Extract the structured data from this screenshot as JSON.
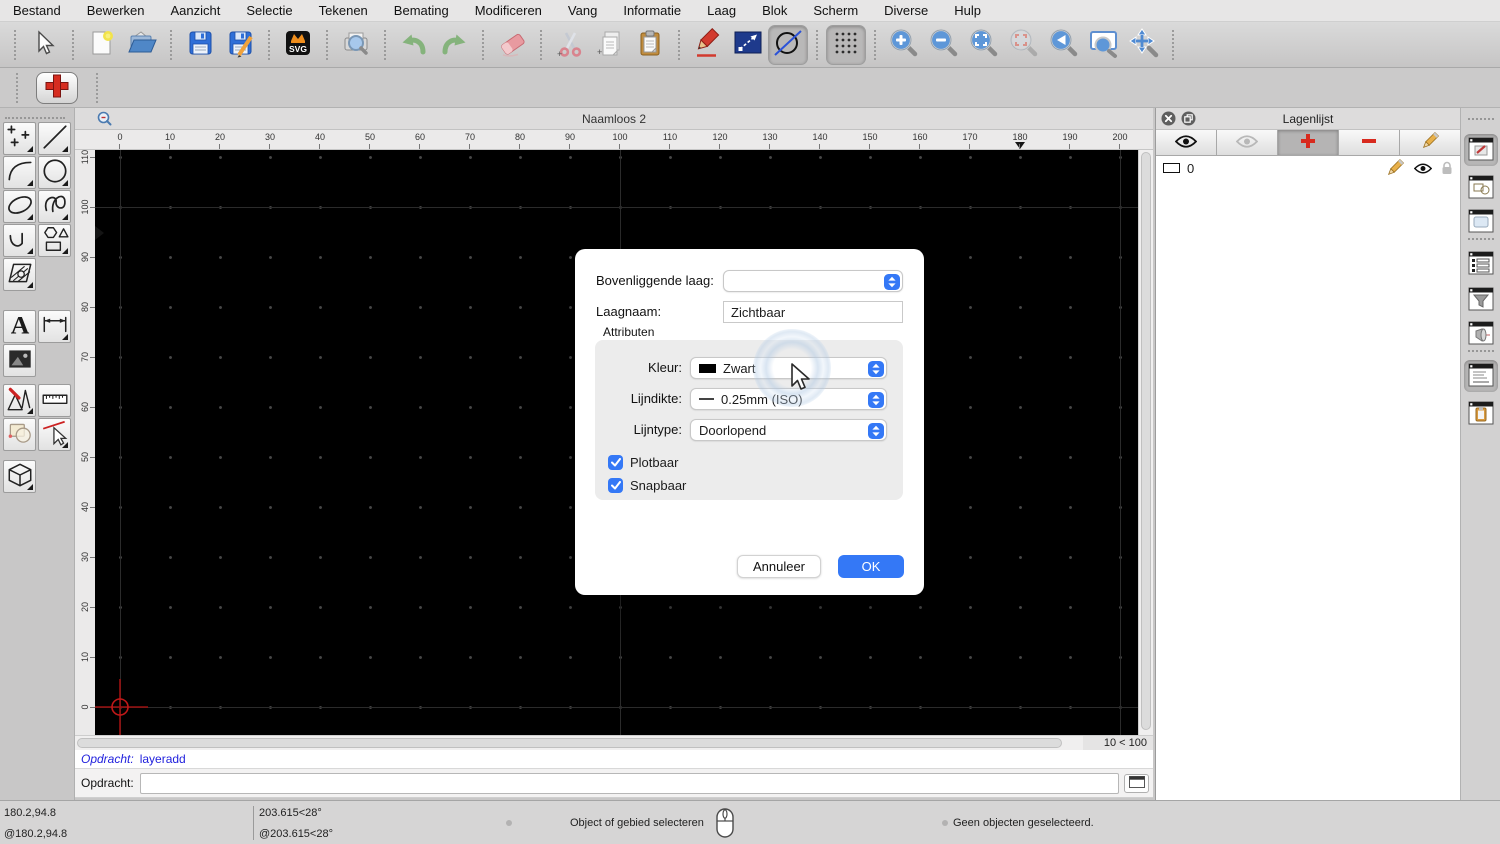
{
  "menu": {
    "items": [
      "Bestand",
      "Bewerken",
      "Aanzicht",
      "Selectie",
      "Tekenen",
      "Bemating",
      "Modificeren",
      "Vang",
      "Informatie",
      "Laag",
      "Blok",
      "Scherm",
      "Diverse",
      "Hulp"
    ]
  },
  "toolbar": {
    "groups": [
      [
        "select-arrow"
      ],
      [
        "new-file",
        "open-file"
      ],
      [
        "save",
        "save-as"
      ],
      [
        "svg-export"
      ],
      [
        "print-preview"
      ],
      [
        "undo",
        "redo"
      ],
      [
        "eraser"
      ],
      [
        "cut",
        "copy",
        "paste"
      ],
      [
        "draw-pencil",
        "scale-tool",
        "construction-mode"
      ],
      [
        "grid-toggle"
      ],
      [
        "zoom-in",
        "zoom-out",
        "zoom-auto",
        "zoom-selection",
        "zoom-previous",
        "zoom-window",
        "zoom-pan"
      ]
    ],
    "active": [
      "construction-mode",
      "grid-toggle"
    ],
    "disabled": [
      "zoom-selection"
    ]
  },
  "second_toolbar": {
    "add_layer_tool_icon": "red-plus"
  },
  "tool_palette": {
    "rows": [
      [
        {
          "name": "point-tool",
          "flyout": true
        },
        {
          "name": "line-tool",
          "flyout": true
        }
      ],
      [
        {
          "name": "arc-tool",
          "flyout": true
        },
        {
          "name": "circle-tool",
          "flyout": true
        }
      ],
      [
        {
          "name": "ellipse-tool",
          "flyout": true
        },
        {
          "name": "spline-tool",
          "flyout": true
        }
      ],
      [
        {
          "name": "polyline-tool",
          "flyout": true
        },
        {
          "name": "shape-tool",
          "flyout": true
        }
      ],
      [
        {
          "name": "hatch-tool",
          "flyout": true
        }
      ],
      [
        {
          "name": "text-tool",
          "flyout": false
        },
        {
          "name": "dimension-tool",
          "flyout": true
        }
      ],
      [
        {
          "name": "image-tool",
          "flyout": false
        }
      ],
      [
        {
          "name": "cad-draw-tool",
          "flyout": true
        },
        {
          "name": "measure-tool",
          "flyout": false
        }
      ],
      [
        {
          "name": "modify-tool",
          "flyout": false
        },
        {
          "name": "snap-tool",
          "flyout": true
        }
      ],
      [
        {
          "name": "solid-tool",
          "flyout": true
        }
      ]
    ]
  },
  "document_window": {
    "title": "Naamloos 2",
    "h_ruler_values": [
      0,
      10,
      20,
      30,
      40,
      50,
      60,
      70,
      80,
      90,
      100,
      110,
      120,
      130,
      140,
      150,
      160,
      170,
      180,
      190,
      200
    ],
    "v_ruler_values": [
      110,
      100,
      90,
      80,
      70,
      60,
      50,
      40,
      30,
      20,
      10,
      0
    ],
    "h_marker_value": 180,
    "grid_status": "10 < 100"
  },
  "dialog": {
    "parent_layer_label": "Bovenliggende laag:",
    "parent_layer_value": "",
    "layer_name_label": "Laagnaam:",
    "layer_name_value": "Zichtbaar",
    "attributes_label": "Attributen",
    "color_label": "Kleur:",
    "color_value": "Zwart",
    "color_swatch": "#000000",
    "lineweight_label": "Lijndikte:",
    "lineweight_value": "0.25mm (ISO)",
    "linetype_label": "Lijntype:",
    "linetype_value": "Doorlopend",
    "checkboxes": [
      {
        "label": "Plotbaar",
        "checked": true
      },
      {
        "label": "Snapbaar",
        "checked": true
      }
    ],
    "cancel_label": "Annuleer",
    "ok_label": "OK"
  },
  "layer_panel": {
    "title": "Lagenlijst",
    "toolbar": [
      {
        "name": "show-all-layers",
        "icon": "eye",
        "active": false
      },
      {
        "name": "hide-all-layers",
        "icon": "eye-gray",
        "active": false
      },
      {
        "name": "add-layer",
        "icon": "red-plus-small",
        "active": true
      },
      {
        "name": "remove-layer",
        "icon": "red-minus",
        "active": false
      },
      {
        "name": "edit-layer",
        "icon": "pencil",
        "active": false
      }
    ],
    "rows": [
      {
        "name": "0",
        "swatch": "#FFFFFF"
      }
    ]
  },
  "side_strip": {
    "items": [
      {
        "name": "layer-list-panel",
        "active": true
      },
      {
        "name": "block-list-panel",
        "active": false
      },
      {
        "name": "library-browser-panel",
        "active": false
      },
      {
        "name": "list-view-panel",
        "active": false,
        "sep_before": true
      },
      {
        "name": "selection-filter-panel",
        "active": false
      },
      {
        "name": "view-panel",
        "active": false
      },
      {
        "name": "command-line-panel",
        "active": true,
        "sep_before": true
      },
      {
        "name": "property-editor-panel",
        "active": false
      }
    ]
  },
  "command_line": {
    "history_prompt": "Opdracht:",
    "history_command": "layeradd",
    "prompt_label": "Opdracht:",
    "input_value": ""
  },
  "status_bar": {
    "abs_coord": "180.2,94.8",
    "rel_coord": "@180.2,94.8",
    "abs_polar": "203.615<28°",
    "rel_polar": "@203.615<28°",
    "hint": "Object of gebied selecteren",
    "selection_status": "Geen objecten geselecteerd."
  },
  "colors": {
    "accent": "#3478F6",
    "canvas": "#000000",
    "command_text": "#2121DD",
    "red_accent": "#D82A1E"
  }
}
